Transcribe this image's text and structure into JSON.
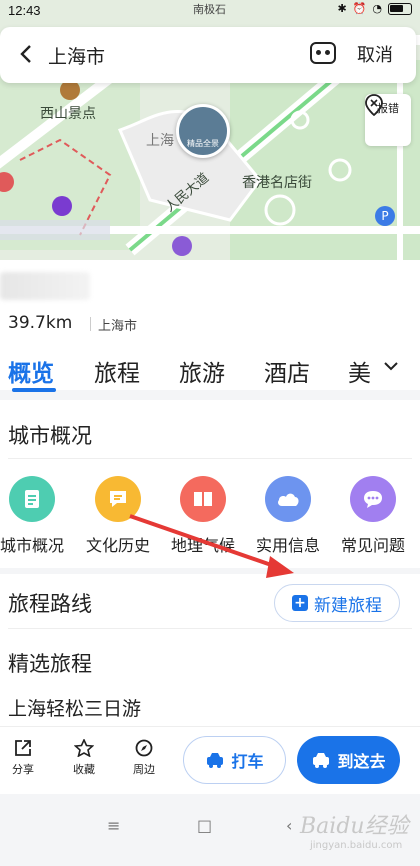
{
  "status_bar": {
    "time": "12:43",
    "carrier_text": "南极石",
    "battery": "95"
  },
  "search": {
    "city": "上海市",
    "cancel_label": "取消"
  },
  "map": {
    "labels": {
      "west_hill": "西山景点",
      "people_avenue": "人民大道",
      "hongkong_street": "香港名店街",
      "shanghai": "上海",
      "report": "报错",
      "photo_caption": "精品全景"
    }
  },
  "info": {
    "distance": "39.7km",
    "location": "上海市"
  },
  "tabs": [
    {
      "label": "概览",
      "active": true
    },
    {
      "label": "旅程"
    },
    {
      "label": "旅游"
    },
    {
      "label": "酒店"
    },
    {
      "label": "美"
    }
  ],
  "overview": {
    "title": "城市概况",
    "categories": [
      {
        "label": "城市概况",
        "icon": "document-icon",
        "color": "#4ecdb1"
      },
      {
        "label": "文化历史",
        "icon": "comment-icon",
        "color": "#f8b933"
      },
      {
        "label": "地理气候",
        "icon": "book-icon",
        "color": "#f46a5e"
      },
      {
        "label": "实用信息",
        "icon": "cloud-icon",
        "color": "#6d94ef"
      },
      {
        "label": "常见问题",
        "icon": "chat-icon",
        "color": "#a17ff0"
      }
    ]
  },
  "itinerary": {
    "title": "旅程路线",
    "new_trip_label": "新建旅程",
    "selected_title": "精选旅程",
    "first_item": "上海轻松三日游"
  },
  "toolbar": {
    "share": "分享",
    "favorite": "收藏",
    "nearby": "周边",
    "taxi": "打车",
    "goto": "到这去"
  },
  "watermark": {
    "main": "Baidu经验",
    "sub": "jingyan.baidu.com"
  },
  "colors": {
    "accent": "#1a73e8",
    "arrow": "#e53935"
  }
}
